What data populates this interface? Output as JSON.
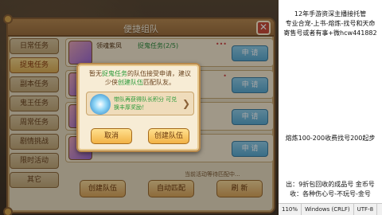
{
  "panel": {
    "title": "便捷组队",
    "close": "✕"
  },
  "sidebar": {
    "items": [
      {
        "label": "日常任务",
        "active": false
      },
      {
        "label": "捉鬼任务",
        "active": true
      },
      {
        "label": "副本任务",
        "active": false
      },
      {
        "label": "鬼王任务",
        "active": false
      },
      {
        "label": "周常任务",
        "active": false
      },
      {
        "label": "剧情挑战",
        "active": false
      },
      {
        "label": "限时活动",
        "active": false
      },
      {
        "label": "其它",
        "active": false
      }
    ]
  },
  "list": {
    "rows": [
      {
        "name": "领魂紫凤",
        "task": "捉鬼任务(2/5)",
        "dots": "•••",
        "button": "申 请"
      },
      {
        "name": "",
        "task": "",
        "dots": "•",
        "button": "申 请"
      },
      {
        "name": "",
        "task": "",
        "dots": "",
        "button": "申 请"
      },
      {
        "name": "",
        "task": "",
        "dots": "",
        "button": "申 请"
      }
    ]
  },
  "bottom": {
    "note": "当前活动等待匹配中...",
    "buttons": [
      "创建队伍",
      "自动匹配",
      "刷 新"
    ]
  },
  "dialog": {
    "line1_prefix": "暂无",
    "line1_task": "捉鬼任务",
    "line1_suffix": "的队伍接受申请，建议",
    "line2_prefix": "少侠",
    "line2_link": "创建队伍",
    "line2_suffix": "匹配队友。",
    "reward": "带队再获得队长积分 可兑换丰厚奖励！",
    "cancel": "取消",
    "create": "创建队伍"
  },
  "side_panel": {
    "line1": "12年手游资深主播接托管",
    "line2": "专业合宠-上书-熔炼-找号和天命",
    "line3": "寄售号或者有事+微hcw441882",
    "line4": "熔炼100-200收费找号200起步",
    "line5": "出：9折包回收的成品号 金币号",
    "line6": "收：各种伤心号-不玩号-金号"
  },
  "statusbar": {
    "zoom": "110%",
    "eol": "Windows (CRLF)",
    "encoding": "UTF-8"
  }
}
